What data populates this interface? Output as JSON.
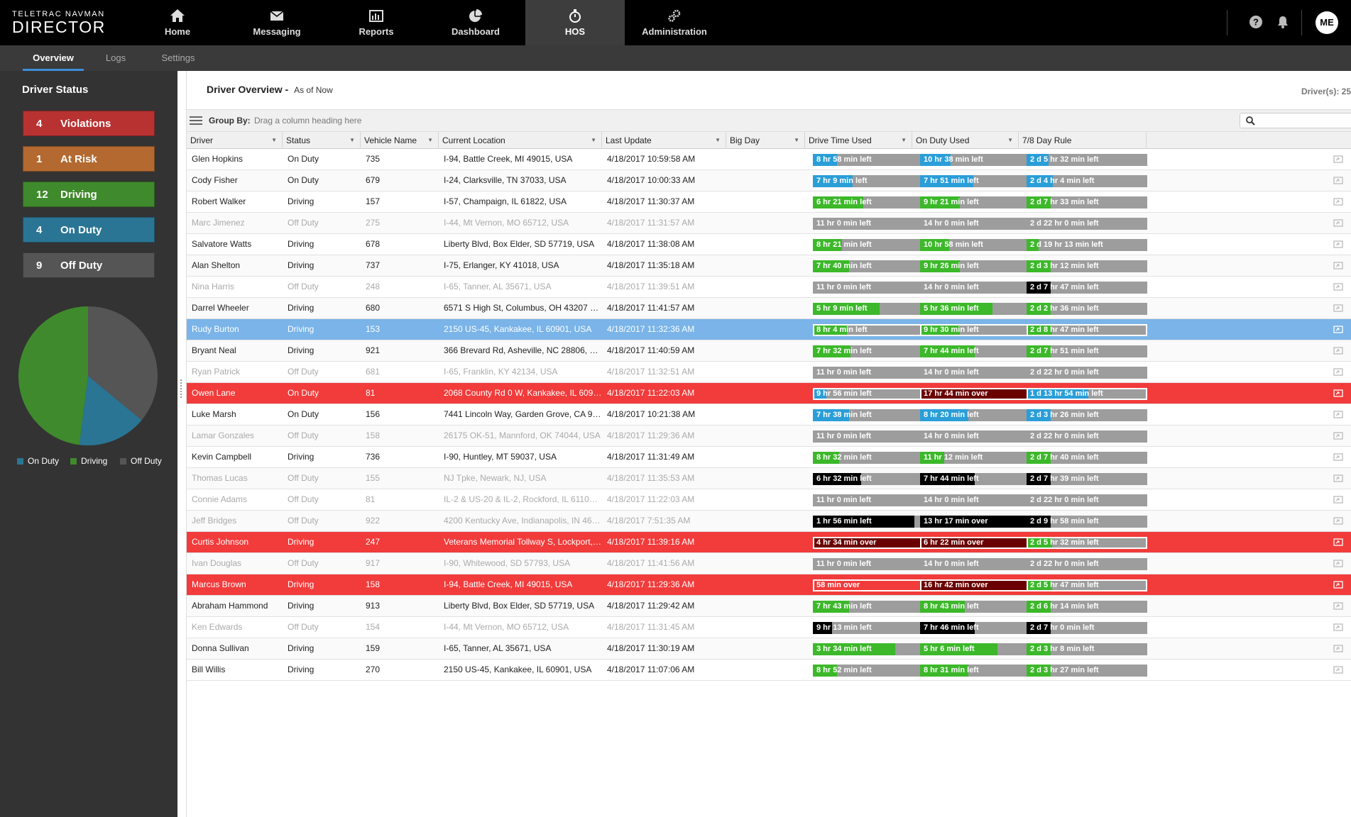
{
  "brand": {
    "line1": "TELETRAC NAVMAN",
    "line2": "DIRECTOR"
  },
  "nav": [
    {
      "id": "home",
      "label": "Home",
      "icon": "home-icon"
    },
    {
      "id": "messaging",
      "label": "Messaging",
      "icon": "envelope-icon"
    },
    {
      "id": "reports",
      "label": "Reports",
      "icon": "bar-chart-icon"
    },
    {
      "id": "dashboard",
      "label": "Dashboard",
      "icon": "pie-chart-icon"
    },
    {
      "id": "hos",
      "label": "HOS",
      "icon": "stopwatch-icon",
      "active": true
    },
    {
      "id": "administration",
      "label": "Administration",
      "icon": "gears-icon"
    }
  ],
  "user": {
    "initials": "ME"
  },
  "subnav": [
    {
      "label": "Overview",
      "active": true
    },
    {
      "label": "Logs"
    },
    {
      "label": "Settings"
    }
  ],
  "sidebar": {
    "title": "Driver Status",
    "statuses": [
      {
        "count": "4",
        "label": "Violations",
        "color": "#b83232"
      },
      {
        "count": "1",
        "label": "At Risk",
        "color": "#b3692f"
      },
      {
        "count": "12",
        "label": "Driving",
        "color": "#3f8a2c"
      },
      {
        "count": "4",
        "label": "On Duty",
        "color": "#2a7594"
      },
      {
        "count": "9",
        "label": "Off Duty",
        "color": "#555555"
      }
    ],
    "pie": [
      {
        "label": "On Duty",
        "value": 4,
        "color": "#2a7594"
      },
      {
        "label": "Driving",
        "value": 12,
        "color": "#3f8a2c"
      },
      {
        "label": "Off Duty",
        "value": 9,
        "color": "#555555"
      }
    ]
  },
  "overview": {
    "title": "Driver Overview -",
    "subtitle": "As of Now",
    "drivers_count": "Driver(s): 25"
  },
  "groupby": {
    "label": "Group By:",
    "hint": "Drag a column heading here",
    "search_placeholder": ""
  },
  "columns": [
    "Driver",
    "Status",
    "Vehicle Name",
    "Current Location",
    "Last Update",
    "Big Day",
    "Drive Time Used",
    "On Duty Used",
    "7/8 Day Rule"
  ],
  "colors": {
    "blue": "#2a9ed8",
    "green": "#3cb82a",
    "dark": "#000000",
    "darkred": "#6a0000",
    "gray": "#9d9d9d",
    "selected": "#7ab4e8",
    "violation": "#f23b3b"
  },
  "rows": [
    {
      "driver": "Glen Hopkins",
      "status": "On Duty",
      "vehicle": "735",
      "location": "I-94, Battle Creek, MI 49015, USA",
      "updated": "4/18/2017 10:59:58 AM",
      "bigday": true,
      "state": "normal",
      "drive": {
        "text": "8 hr 58 min left",
        "color": "blue",
        "pct": 0.2
      },
      "onduty": {
        "text": "10 hr 38 min left",
        "color": "blue",
        "pct": 0.25
      },
      "rule": {
        "text": "2 d 5 hr 32 min left",
        "color": "blue",
        "pct": 0.18
      }
    },
    {
      "driver": "Cody Fisher",
      "status": "On Duty",
      "vehicle": "679",
      "location": "I-24, Clarksville, TN 37033, USA",
      "updated": "4/18/2017 10:00:33 AM",
      "bigday": false,
      "state": "normal",
      "drive": {
        "text": "7 hr 9 min left",
        "color": "blue",
        "pct": 0.33
      },
      "onduty": {
        "text": "7 hr 51 min left",
        "color": "blue",
        "pct": 0.44
      },
      "rule": {
        "text": "2 d 4 hr 4 min left",
        "color": "blue",
        "pct": 0.22
      }
    },
    {
      "driver": "Robert Walker",
      "status": "Driving",
      "vehicle": "157",
      "location": "I-57, Champaign, IL 61822, USA",
      "updated": "4/18/2017 11:30:37 AM",
      "bigday": true,
      "state": "normal",
      "drive": {
        "text": "6 hr 21 min left",
        "color": "green",
        "pct": 0.42
      },
      "onduty": {
        "text": "9 hr 21 min left",
        "color": "green",
        "pct": 0.33
      },
      "rule": {
        "text": "2 d 7 hr 33 min left",
        "color": "green",
        "pct": 0.2
      }
    },
    {
      "driver": "Marc Jimenez",
      "status": "Off Duty",
      "vehicle": "275",
      "location": "I-44, Mt Vernon, MO 65712, USA",
      "updated": "4/18/2017 11:31:57 AM",
      "bigday": false,
      "state": "offduty",
      "drive": {
        "text": "11 hr 0 min left",
        "color": "gray",
        "pct": 0
      },
      "onduty": {
        "text": "14 hr 0 min left",
        "color": "gray",
        "pct": 0
      },
      "rule": {
        "text": "2 d 22 hr 0 min left",
        "color": "gray",
        "pct": 0
      }
    },
    {
      "driver": "Salvatore Watts",
      "status": "Driving",
      "vehicle": "678",
      "location": "Liberty Blvd, Box Elder, SD 57719, USA",
      "updated": "4/18/2017 11:38:08 AM",
      "bigday": false,
      "state": "normal",
      "drive": {
        "text": "8 hr 21 min left",
        "color": "green",
        "pct": 0.24
      },
      "onduty": {
        "text": "10 hr 58 min left",
        "color": "green",
        "pct": 0.24
      },
      "rule": {
        "text": "2 d 19 hr 13 min left",
        "color": "green",
        "pct": 0.1
      }
    },
    {
      "driver": "Alan Shelton",
      "status": "Driving",
      "vehicle": "737",
      "location": "I-75, Erlanger, KY 41018, USA",
      "updated": "4/18/2017 11:35:18 AM",
      "bigday": true,
      "state": "normal",
      "drive": {
        "text": "7 hr 40 min left",
        "color": "green",
        "pct": 0.3
      },
      "onduty": {
        "text": "9 hr 26 min left",
        "color": "green",
        "pct": 0.33
      },
      "rule": {
        "text": "2 d 3 hr 12 min left",
        "color": "green",
        "pct": 0.2
      }
    },
    {
      "driver": "Nina Harris",
      "status": "Off Duty",
      "vehicle": "248",
      "location": "I-65, Tanner, AL 35671, USA",
      "updated": "4/18/2017 11:39:51 AM",
      "bigday": false,
      "state": "offduty",
      "drive": {
        "text": "11 hr 0 min left",
        "color": "gray",
        "pct": 0
      },
      "onduty": {
        "text": "14 hr 0 min left",
        "color": "gray",
        "pct": 0
      },
      "rule": {
        "text": "2 d 7 hr 47 min left",
        "color": "dark",
        "pct": 0.2
      }
    },
    {
      "driver": "Darrel Wheeler",
      "status": "Driving",
      "vehicle": "680",
      "location": "6571 S High St, Columbus, OH 43207 USA",
      "updated": "4/18/2017 11:41:57 AM",
      "bigday": false,
      "state": "normal",
      "drive": {
        "text": "5 hr 9 min left",
        "color": "green",
        "pct": 0.55
      },
      "onduty": {
        "text": "5 hr 36 min left",
        "color": "green",
        "pct": 0.6
      },
      "rule": {
        "text": "2 d 2 hr 36 min left",
        "color": "green",
        "pct": 0.2
      }
    },
    {
      "driver": "Rudy Burton",
      "status": "Driving",
      "vehicle": "153",
      "location": "2150 US-45, Kankakee, IL 60901, USA",
      "updated": "4/18/2017 11:32:36 AM",
      "bigday": false,
      "state": "selected",
      "drive": {
        "text": "8 hr 4 min left",
        "color": "green",
        "pct": 0.27
      },
      "onduty": {
        "text": "9 hr 30 min left",
        "color": "green",
        "pct": 0.32
      },
      "rule": {
        "text": "2 d 8 hr 47 min left",
        "color": "green",
        "pct": 0.2
      }
    },
    {
      "driver": "Bryant Neal",
      "status": "Driving",
      "vehicle": "921",
      "location": "366 Brevard Rd, Asheville, NC 28806, USA",
      "updated": "4/18/2017 11:40:59 AM",
      "bigday": false,
      "state": "normal",
      "drive": {
        "text": "7 hr 32 min left",
        "color": "green",
        "pct": 0.31
      },
      "onduty": {
        "text": "7 hr 44 min left",
        "color": "green",
        "pct": 0.45
      },
      "rule": {
        "text": "2 d 7 hr 51 min left",
        "color": "green",
        "pct": 0.2
      }
    },
    {
      "driver": "Ryan Patrick",
      "status": "Off Duty",
      "vehicle": "681",
      "location": "I-65, Franklin, KY 42134, USA",
      "updated": "4/18/2017 11:32:51 AM",
      "bigday": false,
      "state": "offduty",
      "drive": {
        "text": "11 hr 0 min left",
        "color": "gray",
        "pct": 0
      },
      "onduty": {
        "text": "14 hr 0 min left",
        "color": "gray",
        "pct": 0
      },
      "rule": {
        "text": "2 d 22 hr 0 min left",
        "color": "gray",
        "pct": 0
      }
    },
    {
      "driver": "Owen Lane",
      "status": "On Duty",
      "vehicle": "81",
      "location": "2068 County Rd 0 W, Kankakee, IL 60901, USA",
      "updated": "4/18/2017 11:22:03 AM",
      "bigday": false,
      "state": "violation",
      "drive": {
        "text": "9 hr 56 min left",
        "color": "blue",
        "pct": 0.1
      },
      "onduty": {
        "text": "17 hr 44 min over",
        "color": "darkred",
        "pct": 1
      },
      "rule": {
        "text": "1 d 13 hr 54 min left",
        "color": "blue",
        "pct": 0.5
      }
    },
    {
      "driver": "Luke Marsh",
      "status": "On Duty",
      "vehicle": "156",
      "location": "7441 Lincoln Way, Garden Grove, CA 92841...",
      "updated": "4/18/2017 10:21:38 AM",
      "bigday": false,
      "state": "normal",
      "drive": {
        "text": "7 hr 38 min left",
        "color": "blue",
        "pct": 0.3
      },
      "onduty": {
        "text": "8 hr 20 min left",
        "color": "blue",
        "pct": 0.4
      },
      "rule": {
        "text": "2 d 3 hr 26 min left",
        "color": "blue",
        "pct": 0.2
      }
    },
    {
      "driver": "Lamar Gonzales",
      "status": "Off Duty",
      "vehicle": "158",
      "location": "26175 OK-51, Mannford, OK 74044, USA",
      "updated": "4/18/2017 11:29:36 AM",
      "bigday": false,
      "state": "offduty",
      "drive": {
        "text": "11 hr 0 min left",
        "color": "gray",
        "pct": 0
      },
      "onduty": {
        "text": "14 hr 0 min left",
        "color": "gray",
        "pct": 0
      },
      "rule": {
        "text": "2 d 22 hr 0 min left",
        "color": "gray",
        "pct": 0
      }
    },
    {
      "driver": "Kevin Campbell",
      "status": "Driving",
      "vehicle": "736",
      "location": "I-90, Huntley, MT 59037, USA",
      "updated": "4/18/2017 11:31:49 AM",
      "bigday": true,
      "state": "normal",
      "drive": {
        "text": "8 hr 32 min left",
        "color": "green",
        "pct": 0.22
      },
      "onduty": {
        "text": "11 hr 12 min left",
        "color": "green",
        "pct": 0.2
      },
      "rule": {
        "text": "2 d 7 hr 40 min left",
        "color": "green",
        "pct": 0.2
      }
    },
    {
      "driver": "Thomas Lucas",
      "status": "Off Duty",
      "vehicle": "155",
      "location": "NJ Tpke, Newark, NJ, USA",
      "updated": "4/18/2017 11:35:53 AM",
      "bigday": false,
      "state": "offduty",
      "drive": {
        "text": "6 hr 32 min left",
        "color": "dark",
        "pct": 0.4
      },
      "onduty": {
        "text": "7 hr 44 min left",
        "color": "dark",
        "pct": 0.45
      },
      "rule": {
        "text": "2 d 7 hr 39 min left",
        "color": "dark",
        "pct": 0.2
      }
    },
    {
      "driver": "Connie Adams",
      "status": "Off Duty",
      "vehicle": "81",
      "location": "IL-2 & US-20 & IL-2, Rockford, IL 61102, USA",
      "updated": "4/18/2017 11:22:03 AM",
      "bigday": false,
      "state": "offduty",
      "drive": {
        "text": "11 hr 0 min left",
        "color": "gray",
        "pct": 0
      },
      "onduty": {
        "text": "14 hr 0 min left",
        "color": "gray",
        "pct": 0
      },
      "rule": {
        "text": "2 d 22 hr 0 min left",
        "color": "gray",
        "pct": 0
      }
    },
    {
      "driver": "Jeff Bridges",
      "status": "Off Duty",
      "vehicle": "922",
      "location": "4200 Kentucky Ave, Indianapolis, IN 46221...",
      "updated": "4/18/2017 7:51:35 AM",
      "bigday": false,
      "state": "offduty",
      "drive": {
        "text": "1 hr 56 min left",
        "color": "dark",
        "pct": 0.84
      },
      "onduty": {
        "text": "13 hr 17 min over",
        "color": "dark",
        "pct": 1
      },
      "rule": {
        "text": "2 d 9 hr 58 min left",
        "color": "dark",
        "pct": 0.2
      }
    },
    {
      "driver": "Curtis Johnson",
      "status": "Driving",
      "vehicle": "247",
      "location": "Veterans Memorial Tollway S, Lockport, IL 60...",
      "updated": "4/18/2017 11:39:16 AM",
      "bigday": false,
      "state": "violation",
      "drive": {
        "text": "4 hr 34 min over",
        "color": "darkred",
        "pct": 1
      },
      "onduty": {
        "text": "6 hr 22 min over",
        "color": "darkred",
        "pct": 1
      },
      "rule": {
        "text": "2 d 5 hr 32 min left",
        "color": "green",
        "pct": 0.2
      }
    },
    {
      "driver": "Ivan Douglas",
      "status": "Off Duty",
      "vehicle": "917",
      "location": "I-90, Whitewood, SD 57793, USA",
      "updated": "4/18/2017 11:41:56 AM",
      "bigday": false,
      "state": "offduty",
      "drive": {
        "text": "11 hr 0 min left",
        "color": "gray",
        "pct": 0
      },
      "onduty": {
        "text": "14 hr 0 min left",
        "color": "gray",
        "pct": 0
      },
      "rule": {
        "text": "2 d 22 hr 0 min left",
        "color": "gray",
        "pct": 0
      }
    },
    {
      "driver": "Marcus Brown",
      "status": "Driving",
      "vehicle": "158",
      "location": "I-94, Battle Creek, MI 49015, USA",
      "updated": "4/18/2017 11:29:36 AM",
      "bigday": false,
      "state": "violation",
      "drive": {
        "text": "58 min over",
        "color": "red",
        "pct": 1
      },
      "onduty": {
        "text": "16 hr 42 min over",
        "color": "darkred",
        "pct": 1
      },
      "rule": {
        "text": "2 d 5 hr 47 min left",
        "color": "green",
        "pct": 0.2
      }
    },
    {
      "driver": "Abraham Hammond",
      "status": "Driving",
      "vehicle": "913",
      "location": "Liberty Blvd, Box Elder, SD 57719, USA",
      "updated": "4/18/2017 11:29:42 AM",
      "bigday": false,
      "state": "normal",
      "drive": {
        "text": "7 hr 43 min left",
        "color": "green",
        "pct": 0.3
      },
      "onduty": {
        "text": "8 hr 43 min left",
        "color": "green",
        "pct": 0.37
      },
      "rule": {
        "text": "2 d 6 hr 14 min left",
        "color": "green",
        "pct": 0.2
      }
    },
    {
      "driver": "Ken Edwards",
      "status": "Off Duty",
      "vehicle": "154",
      "location": "I-44, Mt Vernon, MO 65712, USA",
      "updated": "4/18/2017 11:31:45 AM",
      "bigday": false,
      "state": "offduty",
      "drive": {
        "text": "9 hr 13 min left",
        "color": "dark",
        "pct": 0.16
      },
      "onduty": {
        "text": "7 hr 46 min left",
        "color": "dark",
        "pct": 0.45
      },
      "rule": {
        "text": "2 d 7 hr 0 min left",
        "color": "dark",
        "pct": 0.2
      }
    },
    {
      "driver": "Donna Sullivan",
      "status": "Driving",
      "vehicle": "159",
      "location": "I-65, Tanner, AL 35671, USA",
      "updated": "4/18/2017 11:30:19 AM",
      "bigday": false,
      "state": "normal",
      "drive": {
        "text": "3 hr 34 min left",
        "color": "green",
        "pct": 0.68
      },
      "onduty": {
        "text": "5 hr 6 min left",
        "color": "green",
        "pct": 0.64
      },
      "rule": {
        "text": "2 d 3 hr 8 min left",
        "color": "green",
        "pct": 0.2
      }
    },
    {
      "driver": "Bill Willis",
      "status": "Driving",
      "vehicle": "270",
      "location": "2150 US-45, Kankakee, IL 60901, USA",
      "updated": "4/18/2017 11:07:06 AM",
      "bigday": false,
      "state": "normal",
      "drive": {
        "text": "8 hr 52 min left",
        "color": "green",
        "pct": 0.2
      },
      "onduty": {
        "text": "8 hr 31 min left",
        "color": "green",
        "pct": 0.4
      },
      "rule": {
        "text": "2 d 3 hr 27 min left",
        "color": "green",
        "pct": 0.2
      }
    }
  ]
}
